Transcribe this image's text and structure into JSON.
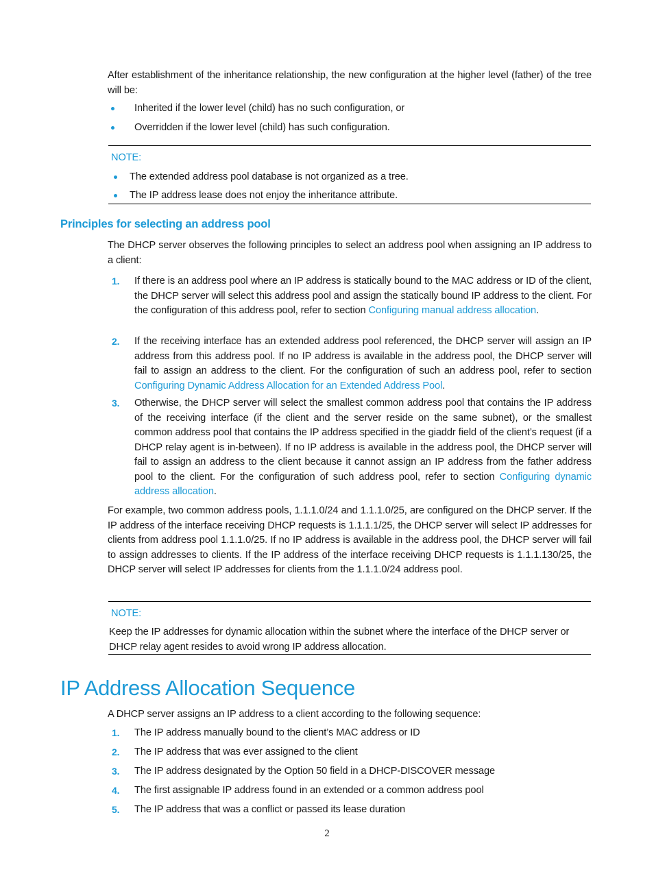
{
  "document": {
    "page_number": "2",
    "accent_color": "#1c9ad6",
    "text_color": "#1a1a1a"
  },
  "intro": {
    "paragraph": "After establishment of the inheritance relationship, the new configuration at the higher level (father) of the tree will be:",
    "bullets": [
      "Inherited if the lower level (child) has no such configuration, or",
      "Overridden if the lower level (child) has such configuration."
    ]
  },
  "note_one": {
    "label": "NOTE:",
    "bullets": [
      "The extended address pool database is not organized as a tree.",
      "The IP address lease does not enjoy the inheritance attribute."
    ]
  },
  "section_principles": {
    "heading": "Principles for selecting an address pool",
    "intro": "The DHCP server observes the following principles to select an address pool when assigning an IP address to a client:",
    "items": [
      {
        "number": "1.",
        "text_before": "If there is an address pool where an IP address is statically bound to the MAC address or ID of the client, the DHCP server will select this address pool and assign the statically bound IP address to the client. For the configuration of this address pool, refer to section ",
        "link": "Configuring manual address allocation",
        "text_after": "."
      },
      {
        "number": "2.",
        "text_before": "If the receiving interface has an extended address pool referenced, the DHCP server will assign an IP address from this address pool. If no IP address is available in the address pool, the DHCP server will fail to assign an address to the client. For the configuration of such an address pool, refer to section ",
        "link": "Configuring Dynamic Address Allocation for an Extended Address Pool",
        "text_after": "."
      },
      {
        "number": "3.",
        "text_before": "Otherwise, the DHCP server will select the smallest common address pool that contains the IP address of the receiving interface (if the client and the server reside on the same subnet), or the smallest common address pool that contains the IP address specified in the giaddr field of the client’s request (if a DHCP relay agent is in-between). If no IP address is available in the address pool, the DHCP server will fail to assign an address to the client because it cannot assign an IP address from the father address pool to the client. For the configuration of such address pool, refer to section ",
        "link": "Configuring dynamic address allocation",
        "text_after": "."
      }
    ],
    "example_paragraph": "For example, two common address pools, 1.1.1.0/24 and 1.1.1.0/25, are configured on the DHCP server. If the IP address of the interface receiving DHCP requests is 1.1.1.1/25, the DHCP server will select IP addresses for clients from address pool 1.1.1.0/25. If no IP address is available in the address pool, the DHCP server will fail to assign addresses to clients. If the IP address of the interface receiving DHCP requests is 1.1.1.130/25, the DHCP server will select IP addresses for clients from the 1.1.1.0/24 address pool."
  },
  "note_two": {
    "label": "NOTE:",
    "text": "Keep the IP addresses for dynamic allocation within the subnet where the interface of the DHCP server or DHCP relay agent resides to avoid wrong IP address allocation."
  },
  "section_sequence": {
    "heading": "IP Address Allocation Sequence",
    "intro": "A DHCP server assigns an IP address to a client according to the following sequence:",
    "items": [
      {
        "number": "1.",
        "text": "The IP address manually bound to the client’s MAC address or ID"
      },
      {
        "number": "2.",
        "text": "The IP address that was ever assigned to the client"
      },
      {
        "number": "3.",
        "text": "The IP address designated by the Option 50 field in a DHCP-DISCOVER message"
      },
      {
        "number": "4.",
        "text": "The first assignable IP address found in an extended or a common address pool"
      },
      {
        "number": "5.",
        "text": "The IP address that was a conflict or passed its lease duration"
      }
    ]
  }
}
